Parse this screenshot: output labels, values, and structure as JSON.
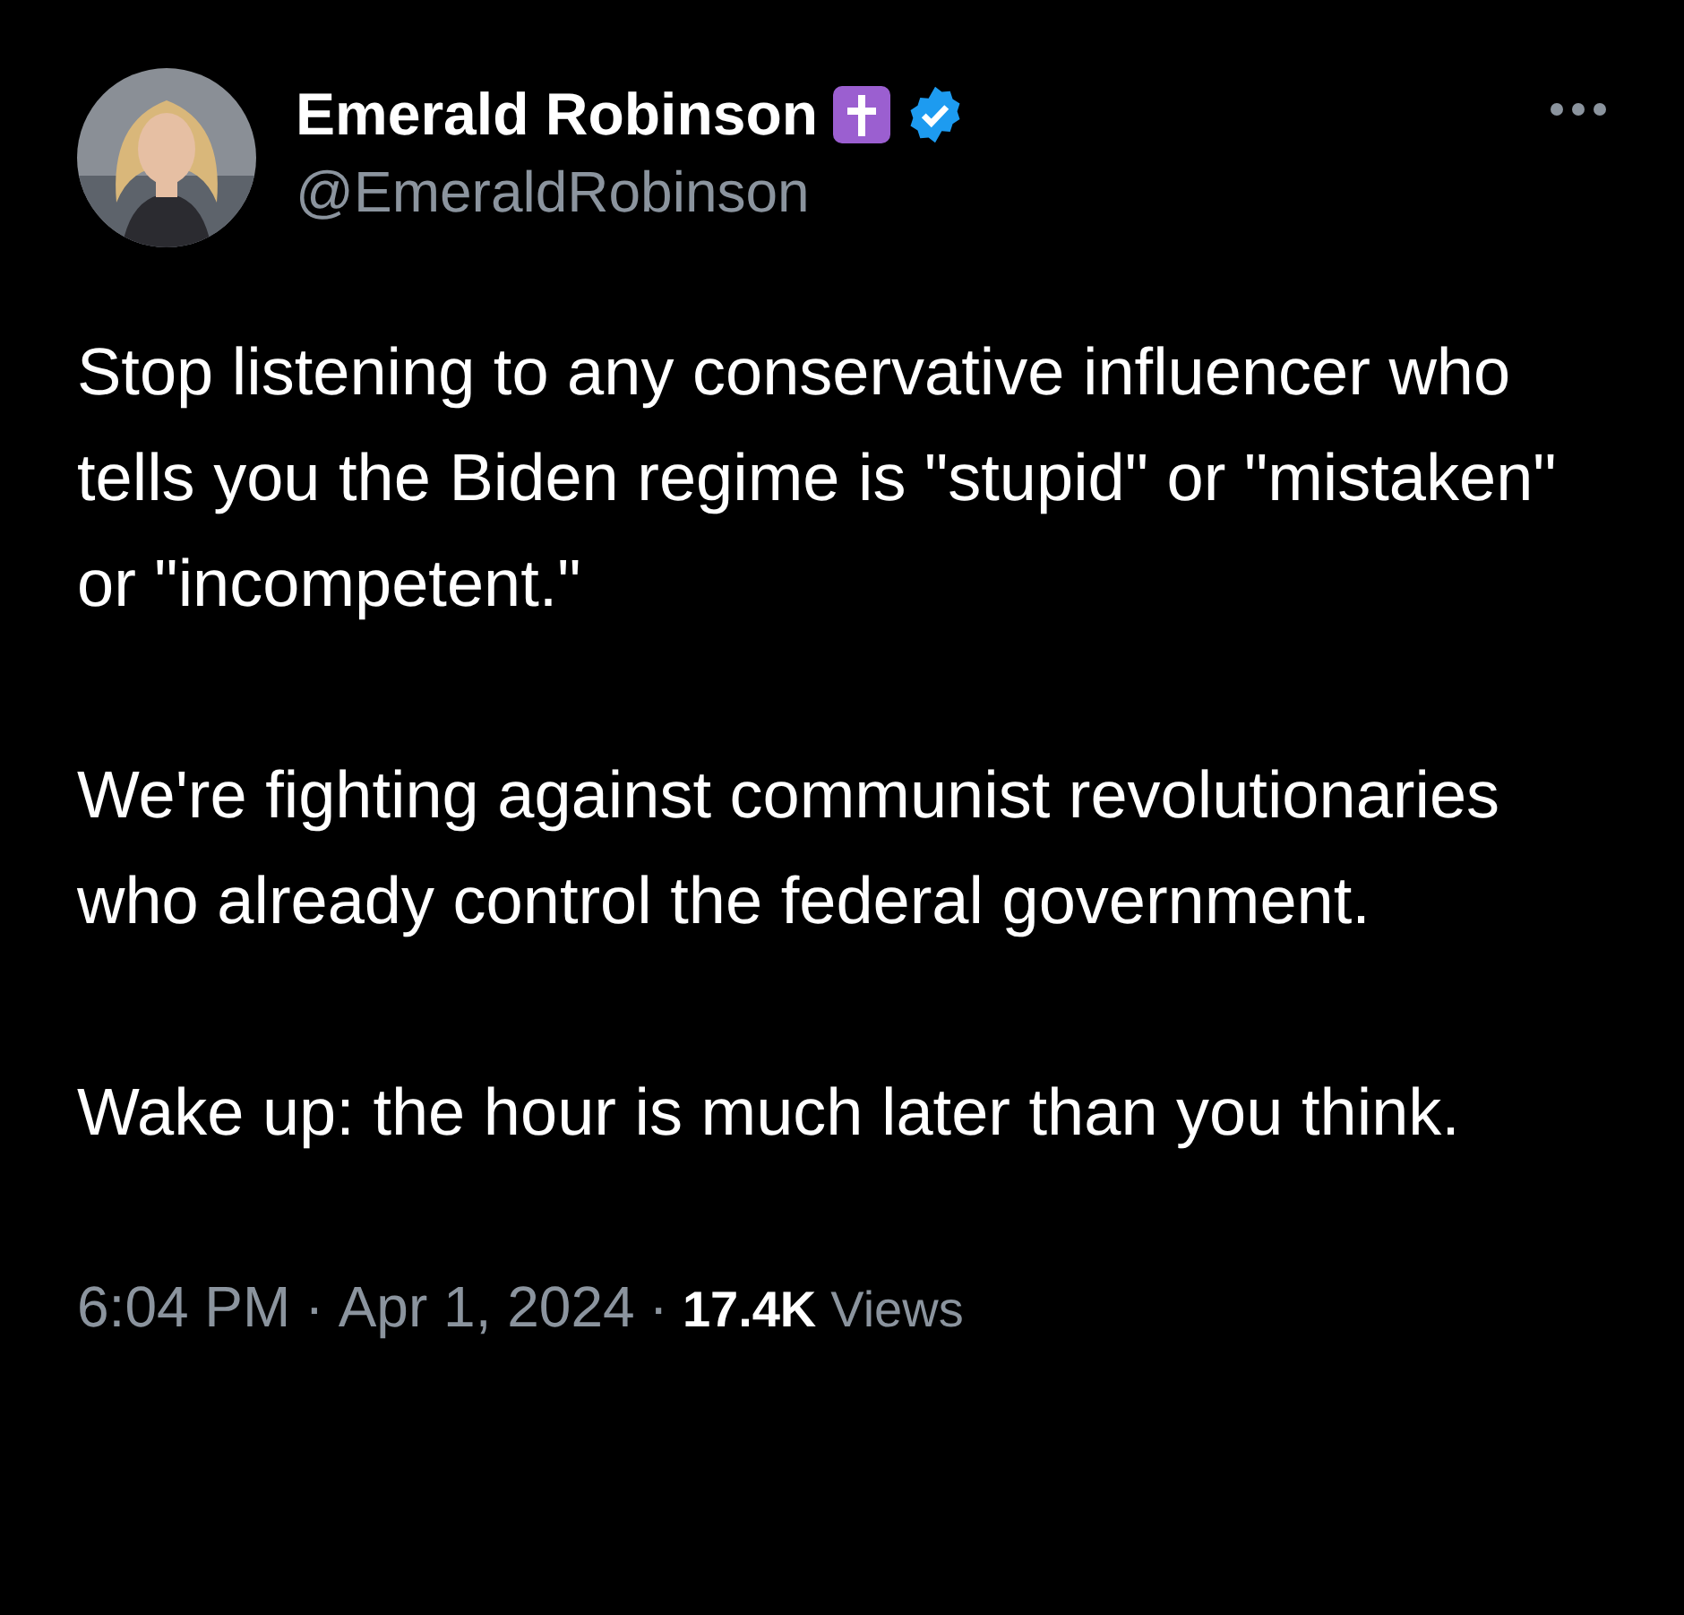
{
  "author": {
    "name": "Emerald Robinson",
    "handle": "@EmeraldRobinson",
    "verified": true
  },
  "paragraphs": [
    "Stop listening to any conservative influencer who tells you the Biden regime is \"stupid\" or \"mistaken\" or \"incompetent.\"",
    "We're fighting against communist revolutionaries who already control the federal government.",
    "Wake up: the hour is much later than you think."
  ],
  "footer": {
    "time": "6:04 PM",
    "separator_1": "·",
    "date": "Apr 1, 2024",
    "separator_2": "·",
    "views_count": "17.4K",
    "views_label": "Views"
  }
}
